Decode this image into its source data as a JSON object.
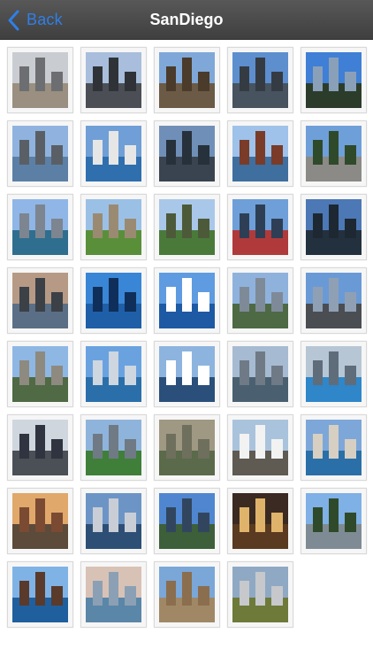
{
  "navbar": {
    "back_label": "Back",
    "title": "SanDiego",
    "back_icon": "chevron-left-icon",
    "accent": "#2f7fe6"
  },
  "gallery": {
    "photos": [
      {
        "sky": "#c9ccd0",
        "ground": "#9a8f80",
        "b": "#6c6e72"
      },
      {
        "sky": "#a9bedc",
        "ground": "#4b4f55",
        "b": "#2f3338"
      },
      {
        "sky": "#7fa8d8",
        "ground": "#6b5a45",
        "b": "#4a3b2b"
      },
      {
        "sky": "#5d8fcf",
        "ground": "#47535f",
        "b": "#353b42"
      },
      {
        "sky": "#3f7fd6",
        "ground": "#2b3d2a",
        "b": "#8aa0b8"
      },
      {
        "sky": "#8fb3de",
        "ground": "#5c7fa6",
        "b": "#5a5f66"
      },
      {
        "sky": "#6f9fd6",
        "ground": "#2f6fae",
        "b": "#e6e6e6"
      },
      {
        "sky": "#6f8fb8",
        "ground": "#3a4450",
        "b": "#26313b"
      },
      {
        "sky": "#9ec2ea",
        "ground": "#3f6f9e",
        "b": "#7a3b28"
      },
      {
        "sky": "#6f9fd8",
        "ground": "#8b8a86",
        "b": "#2f4a2a"
      },
      {
        "sky": "#8fb6e6",
        "ground": "#2f6e8e",
        "b": "#7d8591"
      },
      {
        "sky": "#9ac0e6",
        "ground": "#5a8f3a",
        "b": "#9b8a72"
      },
      {
        "sky": "#a9c7e8",
        "ground": "#4a7a3a",
        "b": "#4d5a3a"
      },
      {
        "sky": "#6f9fd8",
        "ground": "#b03a3a",
        "b": "#2e3f55"
      },
      {
        "sky": "#4c78b5",
        "ground": "#23303e",
        "b": "#1d2833"
      },
      {
        "sky": "#b69a86",
        "ground": "#5a6f86",
        "b": "#3c4047"
      },
      {
        "sky": "#3a86d6",
        "ground": "#1f5fa8",
        "b": "#0f2f5a"
      },
      {
        "sky": "#5f9be0",
        "ground": "#1e5aa3",
        "b": "#ffffff"
      },
      {
        "sky": "#8fb2dc",
        "ground": "#4d6a45",
        "b": "#7f8a98"
      },
      {
        "sky": "#6a9ad6",
        "ground": "#4a4d52",
        "b": "#8fa0b5"
      },
      {
        "sky": "#8eb7e4",
        "ground": "#4f6a44",
        "b": "#8e8a80"
      },
      {
        "sky": "#6aa2e0",
        "ground": "#2b6faa",
        "b": "#ced6df"
      },
      {
        "sky": "#8db4de",
        "ground": "#2a4f7a",
        "b": "#ffffff"
      },
      {
        "sky": "#a6bbd2",
        "ground": "#4a6070",
        "b": "#6f7a86"
      },
      {
        "sky": "#b7c6d4",
        "ground": "#2f86c9",
        "b": "#5f6d7b"
      },
      {
        "sky": "#cfd6de",
        "ground": "#4b4f56",
        "b": "#2f3440"
      },
      {
        "sky": "#8fb4dc",
        "ground": "#3f7f3a",
        "b": "#6f7a84"
      },
      {
        "sky": "#9f9882",
        "ground": "#5a6a4a",
        "b": "#6f6f5e"
      },
      {
        "sky": "#a9c3dc",
        "ground": "#5f5a52",
        "b": "#f2f2f2"
      },
      {
        "sky": "#7da7d8",
        "ground": "#2a6fa8",
        "b": "#d7cfc2"
      },
      {
        "sky": "#e0a86b",
        "ground": "#5c4a3a",
        "b": "#7b4a32"
      },
      {
        "sky": "#6c95c6",
        "ground": "#2e4f75",
        "b": "#c9ced6"
      },
      {
        "sky": "#4f86cf",
        "ground": "#3d5f3a",
        "b": "#31465e"
      },
      {
        "sky": "#3b2a22",
        "ground": "#5a3a20",
        "b": "#e0b36a"
      },
      {
        "sky": "#7fb0e6",
        "ground": "#7f8b94",
        "b": "#2f4a2a"
      },
      {
        "sky": "#7fb3e6",
        "ground": "#1f5f9e",
        "b": "#5a3a2a"
      },
      {
        "sky": "#d8c2b6",
        "ground": "#5a86a8",
        "b": "#8ba0b4"
      },
      {
        "sky": "#7aa6d8",
        "ground": "#a08866",
        "b": "#8a6e4e"
      },
      {
        "sky": "#8fa9c4",
        "ground": "#6e7a3a",
        "b": "#c6c8cc"
      }
    ]
  }
}
